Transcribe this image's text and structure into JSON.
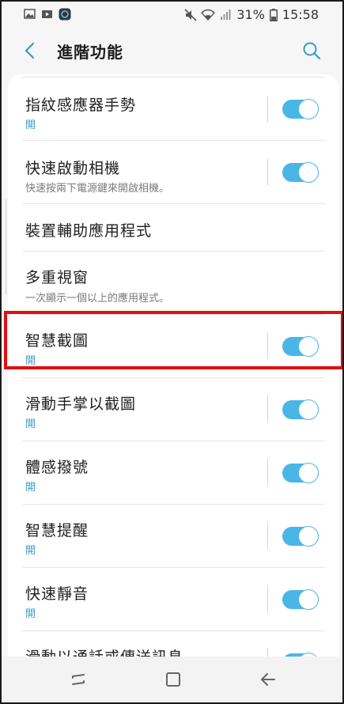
{
  "status_bar": {
    "battery": "31%",
    "time": "15:58"
  },
  "header": {
    "title": "進階功能"
  },
  "rows": [
    {
      "title": "指紋感應器手勢",
      "subtitle": "開",
      "toggle": true
    },
    {
      "title": "快速啟動相機",
      "subtitle": "快速按兩下電源鍵來開啟相機。",
      "toggle": true
    },
    {
      "title": "裝置輔助應用程式",
      "subtitle": "",
      "toggle": false
    },
    {
      "title": "多重視窗",
      "subtitle": "一次顯示一個以上的應用程式。",
      "toggle": false
    },
    {
      "title": "智慧截圖",
      "subtitle": "開",
      "toggle": true
    },
    {
      "title": "滑動手掌以截圖",
      "subtitle": "開",
      "toggle": true
    },
    {
      "title": "體感撥號",
      "subtitle": "開",
      "toggle": true
    },
    {
      "title": "智慧提醒",
      "subtitle": "開",
      "toggle": true
    },
    {
      "title": "快速靜音",
      "subtitle": "開",
      "toggle": true
    },
    {
      "title": "滑動以通話或傳送訊息",
      "subtitle": "",
      "toggle": true
    }
  ],
  "colors": {
    "accent": "#4ab6e8",
    "highlight": "#e01010"
  }
}
